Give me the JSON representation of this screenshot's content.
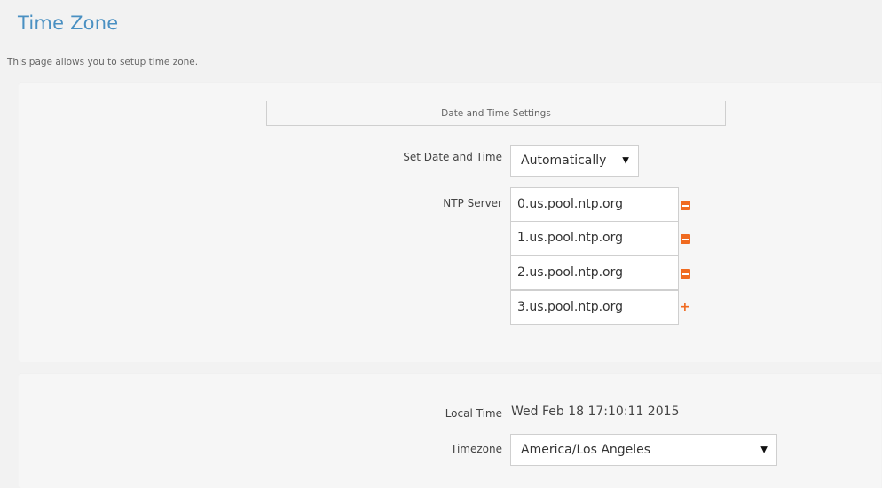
{
  "page": {
    "title": "Time Zone",
    "description": "This page allows you to setup time zone."
  },
  "date_time_settings": {
    "section_title": "Date and Time Settings",
    "set_date_time_label": "Set Date and Time",
    "set_date_time_value": "Automatically",
    "ntp_label": "NTP Server",
    "ntp_servers": [
      "0.us.pool.ntp.org",
      "1.us.pool.ntp.org",
      "2.us.pool.ntp.org",
      "3.us.pool.ntp.org"
    ],
    "remove_icon": "minus-square-icon",
    "add_icon": "plus-icon",
    "accent_color": "#f06a1f"
  },
  "time": {
    "local_time_label": "Local Time",
    "local_time_value": "Wed Feb 18 17:10:11 2015",
    "timezone_label": "Timezone",
    "timezone_value": "America/Los Angeles"
  }
}
